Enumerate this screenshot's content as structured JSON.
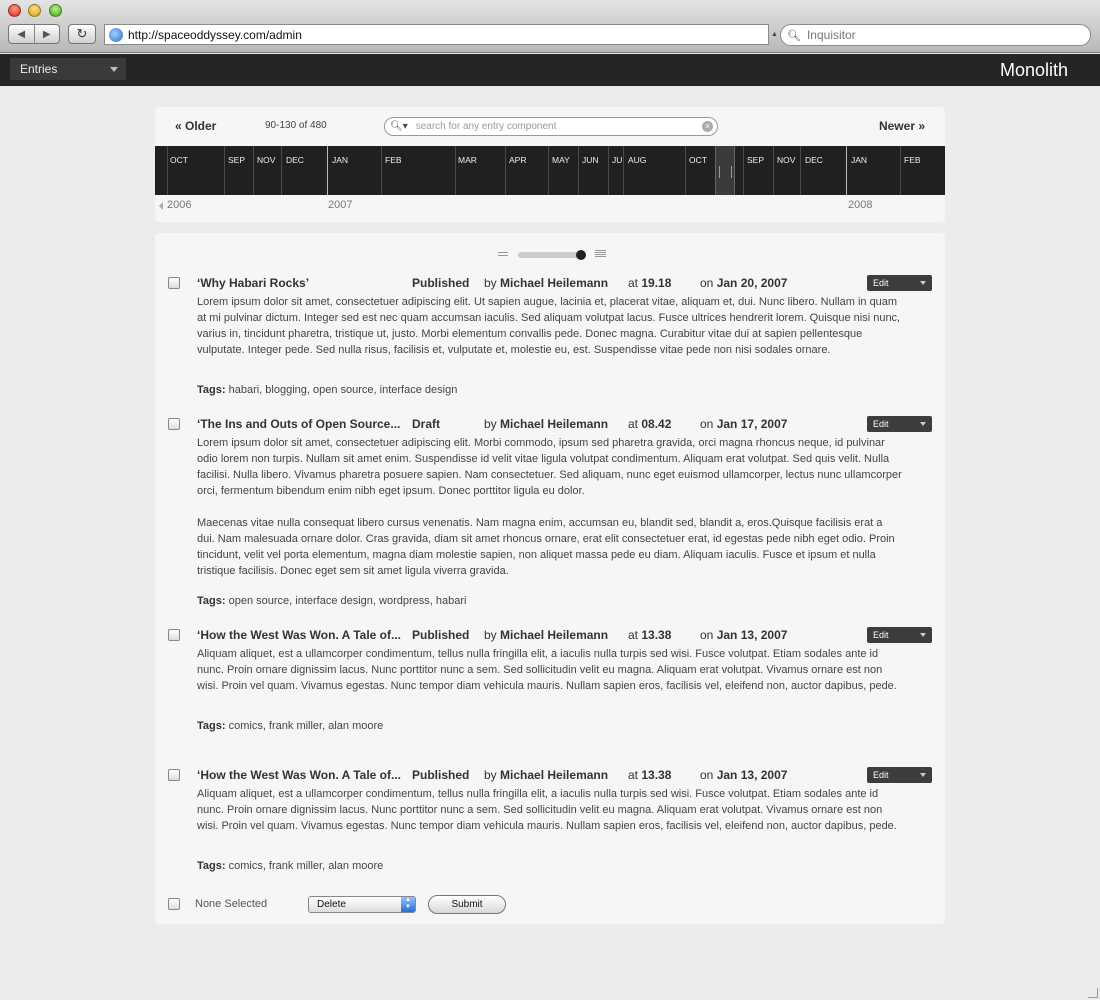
{
  "browser": {
    "url": "http://spaceoddyssey.com/admin",
    "search_placeholder": "Inquisitor",
    "back_icon": "back-arrow-icon",
    "forward_icon": "forward-arrow-icon",
    "reload_icon": "reload-icon"
  },
  "app": {
    "section_select": "Entries",
    "brand": "Monolith"
  },
  "timeline": {
    "older": "« Older",
    "range": "90-130 of 480",
    "search_placeholder": "search for any entry component",
    "newer": "Newer »",
    "months": [
      "OCT",
      "SEP",
      "NOV",
      "DEC",
      "JAN",
      "FEB",
      "MAR",
      "APR",
      "MAY",
      "JUN",
      "JUL",
      "AUG",
      "OCT",
      "SEP",
      "NOV",
      "DEC",
      "JAN",
      "FEB"
    ],
    "years": [
      "2006",
      "2007",
      "2008"
    ]
  },
  "entries": [
    {
      "title": "‘Why Habari Rocks’",
      "status": "Published",
      "by_label": "by",
      "author": "Michael Heilemann",
      "at_label": "at",
      "time": "19.18",
      "on_label": "on",
      "date": "Jan 20, 2007",
      "edit": "Edit",
      "body": [
        "Lorem ipsum dolor sit amet, consectetuer adipiscing elit. Ut sapien augue, lacinia et, placerat vitae, aliquam et, dui. Nunc libero. Nullam in quam at mi pulvinar dictum. Integer sed est nec quam accumsan iaculis. Sed aliquam volutpat lacus. Fusce ultrices hendrerit lorem. Quisque nisi nunc, varius in, tincidunt pharetra, tristique ut, justo. Morbi elementum convallis pede. Donec magna. Curabitur vitae dui at sapien pellentesque vulputate. Integer pede. Sed nulla risus, facilisis et, vulputate et, molestie eu, est. Suspendisse vitae pede non nisi sodales ornare."
      ],
      "tags_label": "Tags:",
      "tags": "habari, blogging, open source, interface design"
    },
    {
      "title": "‘The Ins and Outs of Open Source...",
      "status": "Draft",
      "by_label": "by",
      "author": "Michael Heilemann",
      "at_label": "at",
      "time": "08.42",
      "on_label": "on",
      "date": "Jan 17, 2007",
      "edit": "Edit",
      "body": [
        "Lorem ipsum dolor sit amet, consectetuer adipiscing elit. Morbi commodo, ipsum sed pharetra gravida, orci magna rhoncus neque, id pulvinar odio lorem non turpis. Nullam sit amet enim. Suspendisse id velit vitae ligula volutpat condimentum. Aliquam erat volutpat. Sed quis velit. Nulla facilisi. Nulla libero. Vivamus pharetra posuere sapien. Nam consectetuer. Sed aliquam, nunc eget euismod ullamcorper, lectus nunc ullamcorper orci, fermentum bibendum enim nibh eget ipsum. Donec porttitor ligula eu dolor.",
        "Maecenas vitae nulla consequat libero cursus venenatis. Nam magna enim, accumsan eu, blandit sed, blandit a, eros.Quisque facilisis erat a dui. Nam malesuada ornare dolor. Cras gravida, diam sit amet rhoncus ornare, erat elit consectetuer erat, id egestas pede nibh eget odio. Proin tincidunt, velit vel porta elementum, magna diam molestie sapien, non aliquet massa pede eu diam. Aliquam iaculis. Fusce et ipsum et nulla tristique facilisis. Donec eget sem sit amet ligula viverra gravida."
      ],
      "tags_label": "Tags:",
      "tags": "open source, interface design, wordpress, habari"
    },
    {
      "title": "‘How the West Was Won. A Tale of...",
      "status": "Published",
      "by_label": "by",
      "author": "Michael Heilemann",
      "at_label": "at",
      "time": "13.38",
      "on_label": "on",
      "date": "Jan 13, 2007",
      "edit": "Edit",
      "body": [
        "Aliquam aliquet, est a ullamcorper condimentum, tellus nulla fringilla elit, a iaculis nulla turpis sed wisi. Fusce volutpat. Etiam sodales ante id nunc. Proin ornare dignissim lacus. Nunc porttitor nunc a sem. Sed sollicitudin velit eu magna. Aliquam erat volutpat. Vivamus ornare est non wisi. Proin vel quam. Vivamus egestas. Nunc tempor diam vehicula mauris. Nullam sapien eros, facilisis vel, eleifend non, auctor dapibus, pede."
      ],
      "tags_label": "Tags:",
      "tags": "comics, frank miller, alan moore"
    },
    {
      "title": "‘How the West Was Won. A Tale of...",
      "status": "Published",
      "by_label": "by",
      "author": "Michael Heilemann",
      "at_label": "at",
      "time": "13.38",
      "on_label": "on",
      "date": "Jan 13, 2007",
      "edit": "Edit",
      "body": [
        "Aliquam aliquet, est a ullamcorper condimentum, tellus nulla fringilla elit, a iaculis nulla turpis sed wisi. Fusce volutpat. Etiam sodales ante id nunc. Proin ornare dignissim lacus. Nunc porttitor nunc a sem. Sed sollicitudin velit eu magna. Aliquam erat volutpat. Vivamus ornare est non wisi. Proin vel quam. Vivamus egestas. Nunc tempor diam vehicula mauris. Nullam sapien eros, facilisis vel, eleifend non, auctor dapibus, pede."
      ],
      "tags_label": "Tags:",
      "tags": "comics, frank miller, alan moore"
    }
  ],
  "footer": {
    "selection": "None Selected",
    "action": "Delete",
    "submit": "Submit"
  }
}
